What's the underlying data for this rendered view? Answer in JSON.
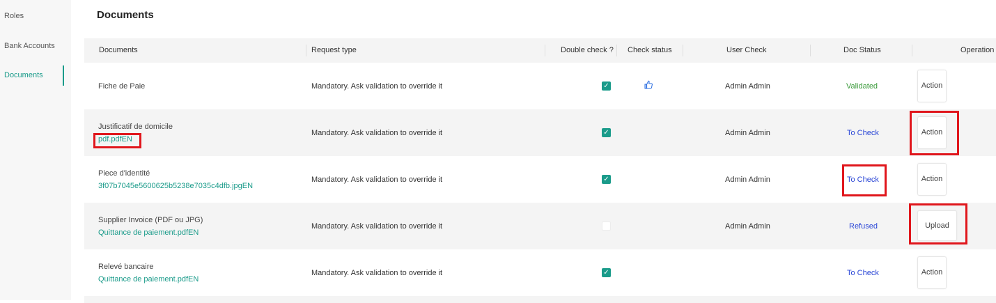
{
  "sidebar": {
    "items": [
      {
        "label": "Roles"
      },
      {
        "label": "Bank Accounts"
      },
      {
        "label": "Documents"
      }
    ]
  },
  "page": {
    "title": "Documents"
  },
  "table": {
    "headers": {
      "documents": "Documents",
      "request_type": "Request type",
      "double_check": "Double check ?",
      "check_status": "Check status",
      "user_check": "User Check",
      "doc_status": "Doc Status",
      "operation": "Operation"
    },
    "rows": [
      {
        "doc_name": "Fiche de Paie",
        "doc_file": "",
        "request_type": "Mandatory. Ask validation to override it",
        "double_check": true,
        "check_status_icon": "thumbs-up-icon",
        "user_check": "Admin Admin",
        "doc_status": "Validated",
        "operation": "Action"
      },
      {
        "doc_name": "Justificatif de domicile",
        "doc_file": "pdf.pdfEN",
        "request_type": "Mandatory. Ask validation to override it",
        "double_check": true,
        "user_check": "Admin Admin",
        "doc_status": "To Check",
        "operation": "Action"
      },
      {
        "doc_name": "Piece d'identité",
        "doc_file": "3f07b7045e5600625b5238e7035c4dfb.jpgEN",
        "request_type": "Mandatory. Ask validation to override it",
        "double_check": true,
        "user_check": "Admin Admin",
        "doc_status": "To Check",
        "operation": "Action"
      },
      {
        "doc_name": "Supplier Invoice (PDF ou JPG)",
        "doc_file": "Quittance de paiement.pdfEN",
        "request_type": "Mandatory. Ask validation to override it",
        "double_check": false,
        "user_check": "Admin Admin",
        "doc_status": "Refused",
        "operation": "Upload"
      },
      {
        "doc_name": "Relevé bancaire",
        "doc_file": "Quittance de paiement.pdfEN",
        "request_type": "Mandatory. Ask validation to override it",
        "double_check": true,
        "user_check": "",
        "doc_status": "To Check",
        "operation": "Action"
      }
    ]
  },
  "colors": {
    "accent": "#1a9b8a",
    "status_validated": "#3a9a3a",
    "status_to_check": "#2a46d6",
    "highlight": "#e0161c"
  }
}
